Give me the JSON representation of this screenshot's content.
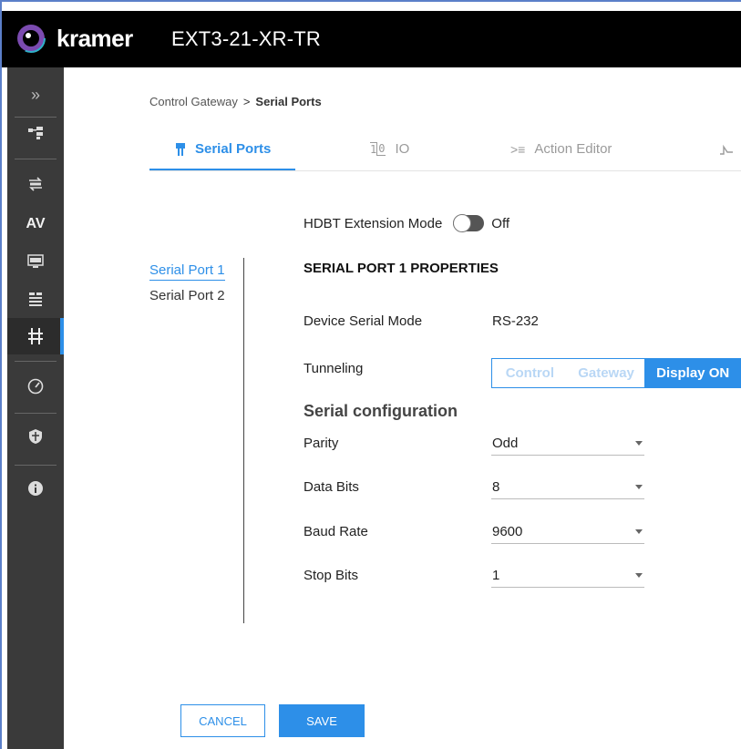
{
  "app": {
    "brand": "kramer",
    "device_name": "EXT3-21-XR-TR"
  },
  "sidebar": {
    "items": [
      {
        "name": "expand",
        "icon": "double-chevron-right-icon",
        "text": "»"
      },
      {
        "name": "routing",
        "icon": "routing-icon",
        "text": ""
      },
      {
        "name": "auto-switching",
        "icon": "auto-switch-icon",
        "text": ""
      },
      {
        "name": "av",
        "icon": "av-icon",
        "text": "AV"
      },
      {
        "name": "edid",
        "icon": "edid-icon",
        "text": ""
      },
      {
        "name": "settings",
        "icon": "device-settings-icon",
        "text": ""
      },
      {
        "name": "control-gateway",
        "icon": "control-gateway-icon",
        "text": ""
      },
      {
        "name": "diagnostics",
        "icon": "gauge-icon",
        "text": ""
      },
      {
        "name": "security",
        "icon": "shield-icon",
        "text": ""
      },
      {
        "name": "about",
        "icon": "info-icon",
        "text": ""
      }
    ]
  },
  "breadcrumb": {
    "parent": "Control Gateway",
    "separator": ">",
    "current": "Serial Ports"
  },
  "tabs": [
    {
      "label": "Serial Ports",
      "icon": "serial-port-icon",
      "active": true
    },
    {
      "label": "IO",
      "icon": "io-icon",
      "active": false
    },
    {
      "label": "Action Editor",
      "icon": "action-editor-icon",
      "active": false
    },
    {
      "label": "",
      "icon": "step-icon",
      "active": false
    }
  ],
  "hdbt": {
    "label": "HDBT Extension Mode",
    "state": "Off"
  },
  "ports": [
    {
      "label": "Serial Port 1",
      "active": true
    },
    {
      "label": "Serial Port 2",
      "active": false
    }
  ],
  "properties": {
    "title": "SERIAL PORT 1 PROPERTIES",
    "device_serial_mode_label": "Device Serial Mode",
    "device_serial_mode_value": "RS-232",
    "tunneling_label": "Tunneling",
    "tunneling_options": [
      "Control",
      "Gateway",
      "Display ON"
    ],
    "tunneling_selected": "Display ON"
  },
  "serial_config": {
    "title": "Serial configuration",
    "parity_label": "Parity",
    "parity_value": "Odd",
    "data_bits_label": "Data Bits",
    "data_bits_value": "8",
    "baud_rate_label": "Baud Rate",
    "baud_rate_value": "9600",
    "stop_bits_label": "Stop Bits",
    "stop_bits_value": "1"
  },
  "actions": {
    "cancel_label": "CANCEL",
    "save_label": "SAVE"
  },
  "colors": {
    "accent": "#2d8fe8",
    "topbar": "#000000",
    "sidebar": "#3a3a3a"
  }
}
